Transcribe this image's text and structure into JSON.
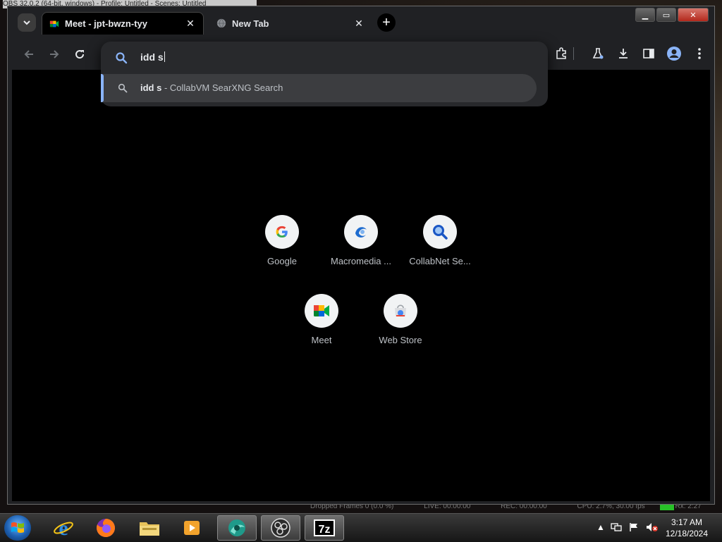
{
  "background": {
    "title_text": "OBS 32.0.2 (64-bit, windows) - Profile: Untitled - Scenes: Untitled",
    "status": [
      "Dropped Frames 0 (0.0 %)",
      "LIVE: 00:00:00",
      "REC: 00:00:00",
      "CPU: 2.7%, 30.00 fps",
      "Rx: 2:27"
    ]
  },
  "browser": {
    "tabs": [
      {
        "title": "Meet - jpt-bwzn-tyy",
        "active": true
      },
      {
        "title": "New Tab",
        "active": false
      }
    ],
    "window_buttons": {
      "minimize": "▁",
      "maximize": "▭",
      "close": "✕"
    },
    "omnibox": {
      "value": "idd s",
      "suggestion": {
        "query": "idd s",
        "separator": " - ",
        "description": "CollabVM SearXNG Search"
      }
    },
    "shortcuts": [
      {
        "label": "Google",
        "icon": "google-icon"
      },
      {
        "label": "Macromedia ...",
        "icon": "macromedia-icon"
      },
      {
        "label": "CollabNet Se...",
        "icon": "search-icon"
      },
      {
        "label": "Meet",
        "icon": "meet-icon"
      },
      {
        "label": "Web Store",
        "icon": "web-store-icon"
      }
    ]
  },
  "taskbar": {
    "apps": [
      "Internet Explorer",
      "Firefox",
      "Windows Explorer",
      "Media Player",
      "Chrome Dev",
      "OBS Studio",
      "7-Zip"
    ],
    "clock": {
      "time": "3:17 AM",
      "date": "12/18/2024"
    },
    "tray_arrow": "▲"
  },
  "colors": {
    "accent": "#8ab4f8",
    "page_bg": "#000000",
    "toolbar_bg": "#202124"
  }
}
